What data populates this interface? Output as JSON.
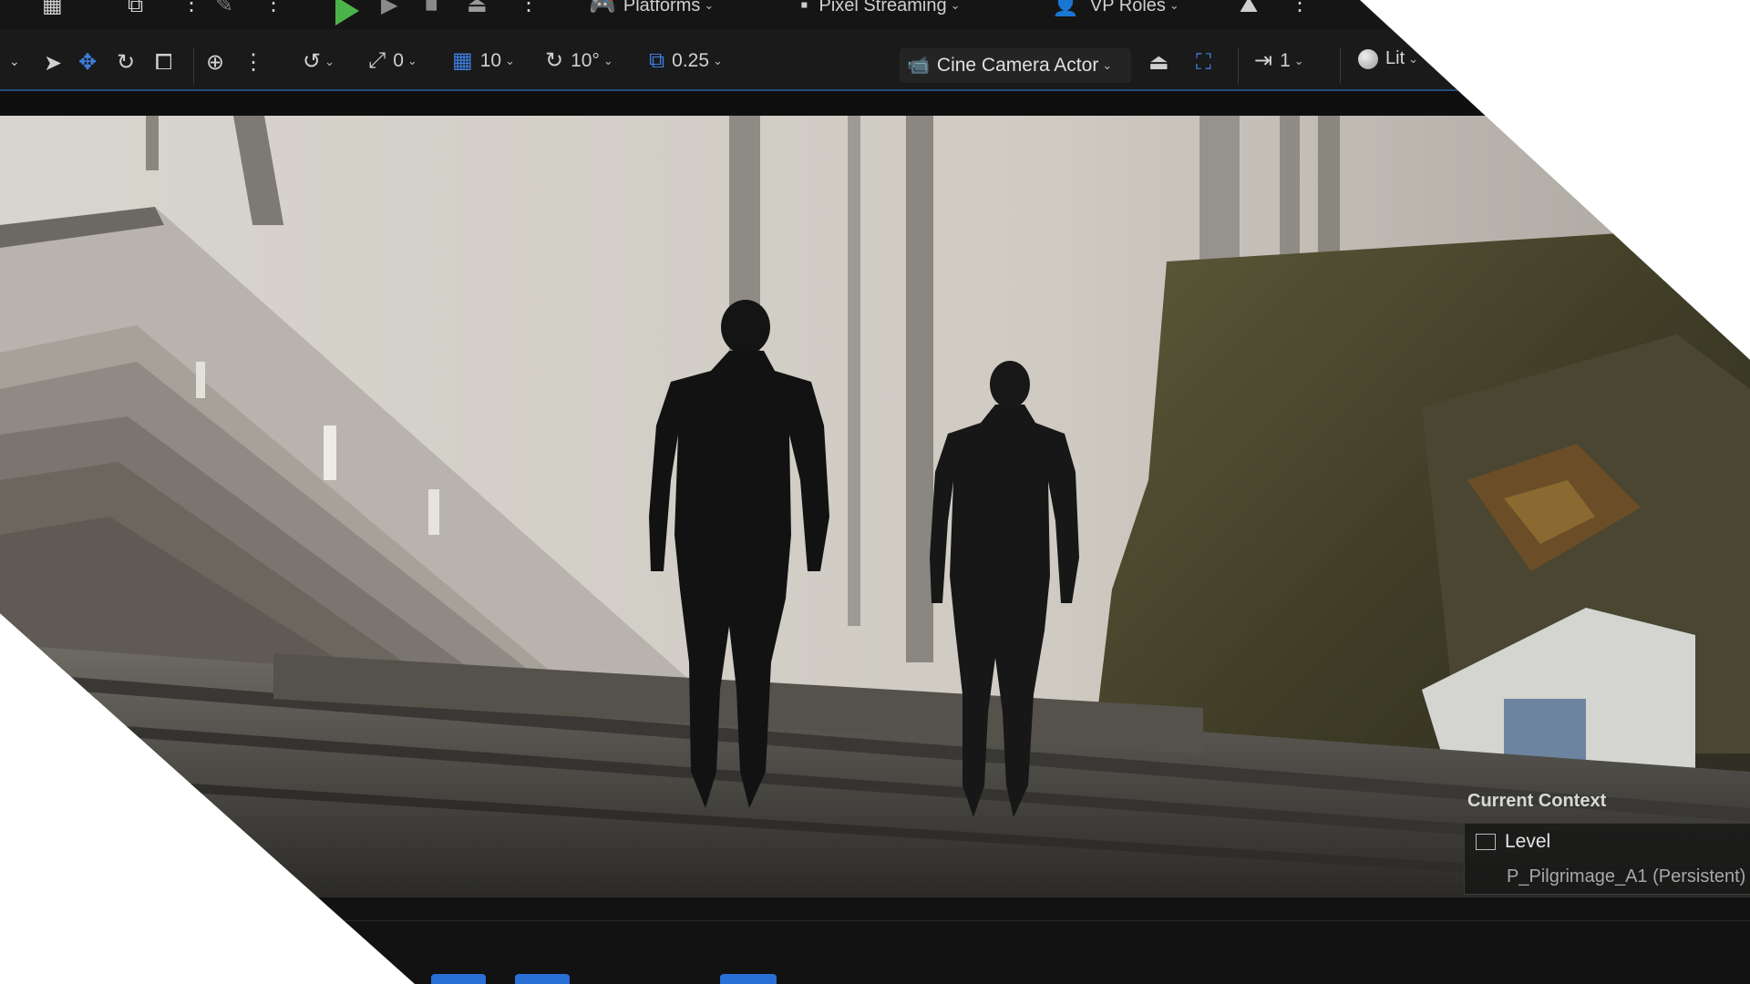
{
  "topbar": {
    "platforms_label": "Platforms",
    "pixel_streaming_label": "Pixel Streaming",
    "vp_roles_label": "VP Roles"
  },
  "toolbar": {
    "surface_snap_value": "0",
    "grid_snap_value": "10",
    "rotation_snap_value": "10°",
    "scale_snap_value": "0.25",
    "camera_actor_label": "Cine Camera Actor",
    "camera_speed_value": "1",
    "view_mode_label": "Lit"
  },
  "context": {
    "title": "Current Context",
    "level_label": "Level",
    "level_name": "P_Pilgrimage_A1 (Persistent)"
  },
  "colors": {
    "play_green": "#4cb34a",
    "accent_blue": "#3d7fe0",
    "toolbar_bg": "#1a1a1a"
  },
  "icons": [
    "select-arrow-icon",
    "move-icon",
    "rotate-icon",
    "scale-icon",
    "world-icon",
    "snap-icon",
    "surface-snap-icon",
    "grid-icon",
    "rotate-snap-icon",
    "scale-snap-icon",
    "camera-icon",
    "eject-icon",
    "pilot-icon",
    "speed-icon",
    "lit-sphere-icon"
  ]
}
